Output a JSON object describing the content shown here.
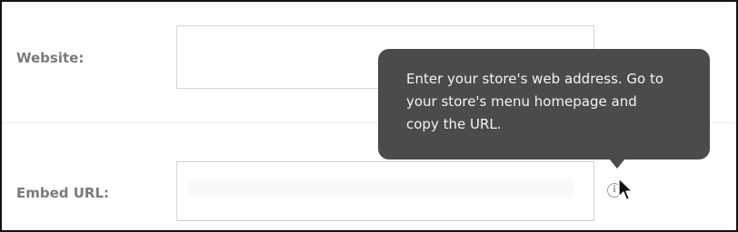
{
  "form": {
    "website": {
      "label": "Website:",
      "value": "",
      "placeholder": ""
    },
    "embed_url": {
      "label": "Embed URL:",
      "value": "",
      "placeholder": ""
    }
  },
  "tooltip": {
    "lines": [
      "Enter your store's web address. Go to",
      "your store's menu homepage and",
      "copy the URL."
    ]
  },
  "icons": {
    "info": "info-icon",
    "cursor": "mouse-cursor-icon"
  },
  "colors": {
    "label": "#7a7a7a",
    "tooltip_bg": "#4b4b4b",
    "tooltip_text": "#f3f3f3",
    "field_border": "#d2d2d2"
  }
}
